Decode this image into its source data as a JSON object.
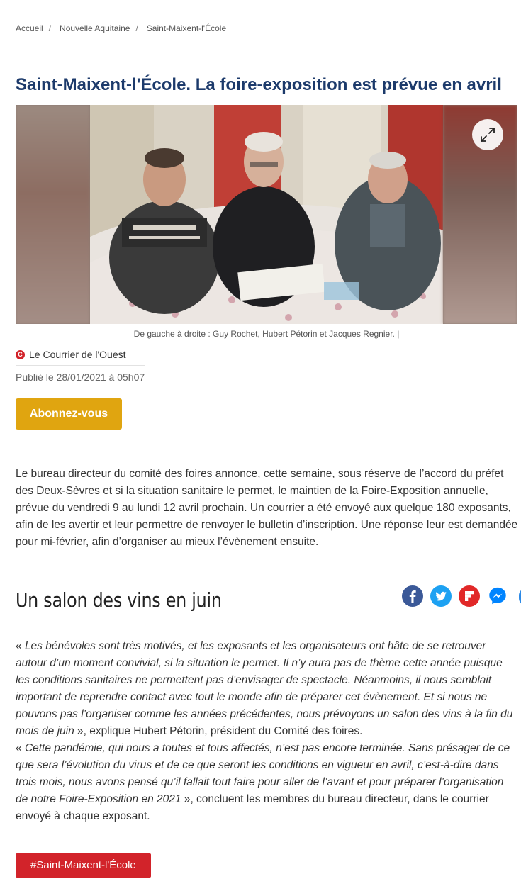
{
  "breadcrumb": {
    "items": [
      "Accueil",
      "Nouvelle Aquitaine",
      "Saint-Maixent-l'École"
    ],
    "separator": "/"
  },
  "article": {
    "title": "Saint-Maixent-l'École. La foire-exposition est prévue en avril",
    "caption": "De gauche à droite : Guy Rochet, Hubert Pétorin et Jacques Regnier. |",
    "source": "Le Courrier de l'Ouest",
    "source_logo_letter": "C",
    "published": "Publié le 28/01/2021 à 05h07",
    "subscribe_label": "Abonnez-vous",
    "intro": "Le bureau directeur du comité des foires annonce, cette semaine, sous réserve de l’accord du préfet des Deux-Sèvres et si la situation sanitaire le permet, le maintien de la Foire-Exposition annuelle, prévue du vendredi 9 au lundi 12 avril prochain. Un courrier a été envoyé aux quelque 180 exposants, afin de les avertir et leur permettre de renvoyer le bulletin d’inscription. Une réponse leur est demandée pour mi-février, afin d’organiser au mieux l’évènement ensuite.",
    "subtitle": "Un salon des vins en juin",
    "p1_open": "« ",
    "p1_quote": "Les bénévoles sont très motivés, et les exposants et les organisateurs ont hâte de se retrouver autour d’un moment convivial, si la situation le permet. Il n’y aura pas de thème cette année puisque les conditions sanitaires ne permettent pas d’envisager de spectacle. Néanmoins, il nous semblait important de reprendre contact avec tout le monde afin de préparer cet évènement. Et si nous ne pouvons pas l’organiser comme les années précédentes, nous prévoyons un salon des vins à la fin du mois de juin",
    "p1_close": " », explique Hubert Pétorin, président du Comité des foires.",
    "p2_open": "« ",
    "p2_quote": "Cette pandémie, qui nous a toutes et tous affectés, n’est pas encore terminée. Sans présager de ce que sera l’évolution du virus et de ce que seront les conditions en vigueur en avril, c’est-à-dire dans trois mois, nous avons pensé qu’il fallait tout faire pour aller de l’avant et pour préparer l’organisation de notre Foire-Exposition en 2021",
    "p2_close": " », concluent les membres du bureau directeur, dans le courrier envoyé à chaque exposant.",
    "tag": "#Saint-Maixent-l'École"
  },
  "share": {
    "buttons": [
      "facebook-icon",
      "twitter-icon",
      "flipboard-icon",
      "messenger-icon"
    ],
    "colors": {
      "facebook": "#3b5998",
      "twitter": "#1da1f2",
      "flipboard": "#e12828",
      "messenger": "#0084ff"
    }
  },
  "colors": {
    "title": "#1c3a6b",
    "subscribe": "#e0a510",
    "tag": "#d2232a"
  }
}
